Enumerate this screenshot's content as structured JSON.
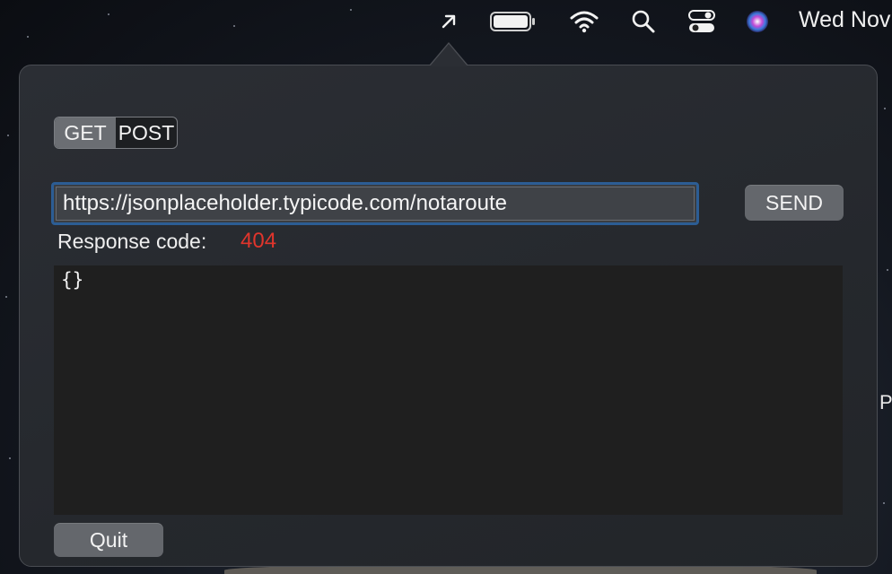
{
  "menubar": {
    "icons": [
      "arrow-up-right-icon",
      "battery-icon",
      "wifi-icon",
      "search-icon",
      "control-center-icon",
      "siri-icon"
    ],
    "clock": "Wed Nov"
  },
  "popover": {
    "methods": [
      "GET",
      "POST"
    ],
    "selected_method": "POST",
    "url_value": "https://jsonplaceholder.typicode.com/notaroute",
    "send_label": "SEND",
    "response_label": "Response code:",
    "response_code": "404",
    "response_code_color": "#e0352c",
    "response_body": "{}",
    "quit_label": "Quit"
  },
  "desktop": {
    "edge_text": "P"
  }
}
